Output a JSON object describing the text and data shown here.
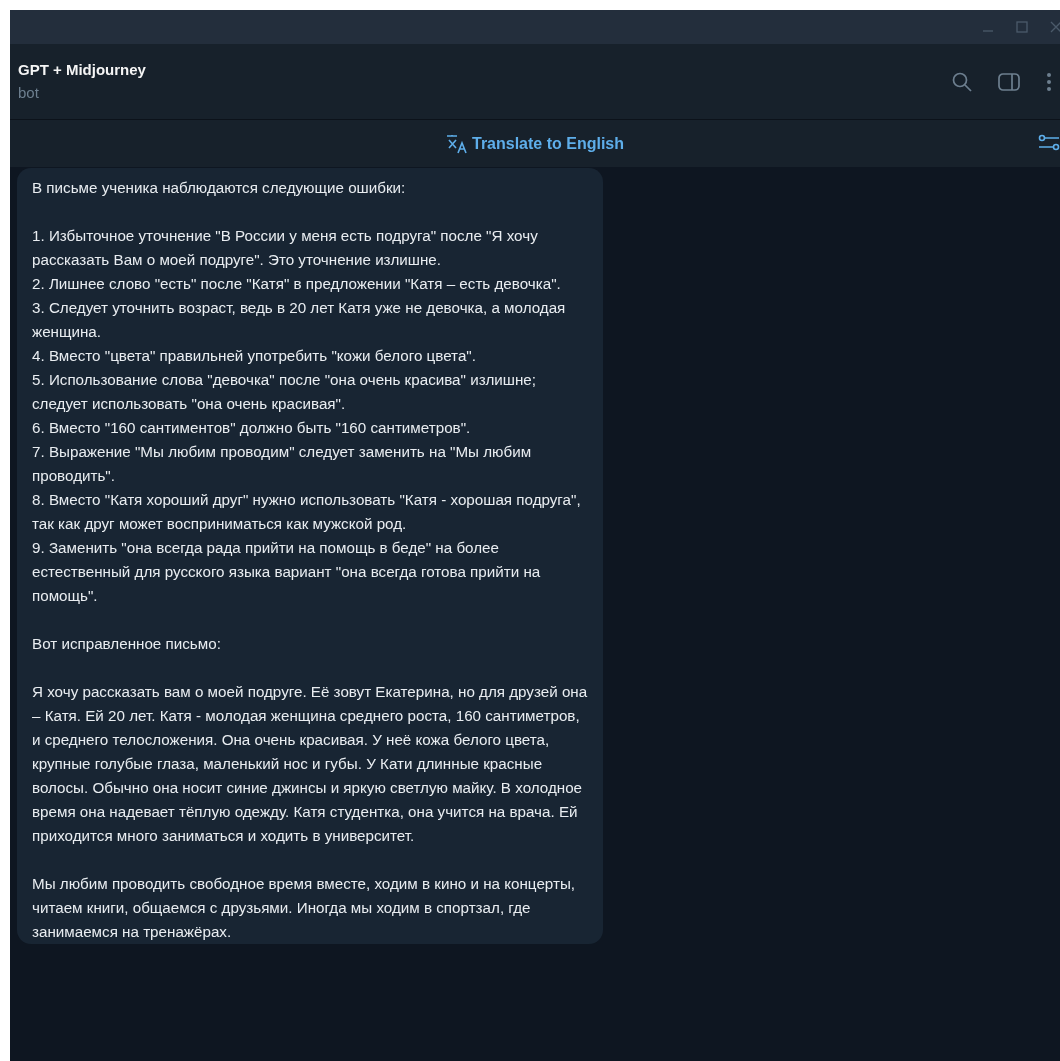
{
  "chat": {
    "title": "GPT + Midjourney",
    "subtitle": "bot"
  },
  "translate_bar": {
    "label": "Translate to English"
  },
  "message": {
    "blocks": [
      {
        "lines": [
          "В письме ученика наблюдаются следующие ошибки:"
        ]
      },
      {
        "lines": [
          "1. Избыточное уточнение \"В России у меня есть подруга\" после \"Я хочу рассказать Вам о моей подруге\". Это уточнение излишне.",
          "2. Лишнее слово \"есть\" после \"Катя\" в предложении \"Катя – есть девочка\".",
          "3. Следует уточнить возраст, ведь в 20 лет Катя уже не девочка, а молодая женщина.",
          "4. Вместо \"цвета\" правильней употребить \"кожи белого цвета\".",
          "5. Использование слова \"девочка\" после \"она очень красива\" излишне; следует использовать \"она очень красивая\".",
          "6. Вместо \"160 сантиментов\" должно быть \"160 сантиметров\".",
          "7. Выражение \"Мы любим проводим\" следует заменить на \"Мы любим проводить\".",
          "8. Вместо \"Катя хороший друг\" нужно использовать \"Катя - хорошая подруга\", так как друг может восприниматься как мужской род.",
          "9. Заменить \"она всегда рада прийти на помощь в беде\" на более естественный для русского языка вариант \"она всегда готова прийти на помощь\"."
        ]
      },
      {
        "lines": [
          "Вот исправленное письмо:"
        ]
      },
      {
        "lines": [
          "Я хочу рассказать вам о моей подруге. Её зовут Екатерина, но для друзей она – Катя. Ей 20 лет. Катя - молодая женщина среднего роста, 160 сантиметров, и среднего телосложения. Она очень красивая. У неё кожа белого цвета, крупные голубые глаза, маленький нос и губы. У Кати длинные красные волосы. Обычно она носит синие джинсы и яркую светлую майку. В холодное время она надевает тёплую одежду. Катя студентка, она учится на врача. Ей приходится много заниматься и ходить в университет."
        ]
      },
      {
        "lines": [
          "Мы любим проводить свободное время вместе, ходим в кино и на концерты, читаем книги, общаемся с друзьями. Иногда мы ходим в спортзал, где занимаемся на тренажёрах."
        ]
      }
    ]
  }
}
